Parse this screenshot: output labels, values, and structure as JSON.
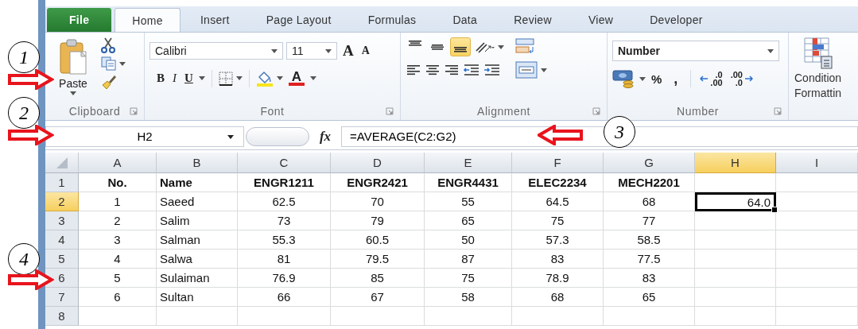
{
  "ribbon_tabs": [
    {
      "label": "File",
      "kind": "file",
      "selected": false
    },
    {
      "label": "Home",
      "kind": "tab",
      "selected": true
    },
    {
      "label": "Insert",
      "kind": "tab",
      "selected": false
    },
    {
      "label": "Page Layout",
      "kind": "tab",
      "selected": false
    },
    {
      "label": "Formulas",
      "kind": "tab",
      "selected": false
    },
    {
      "label": "Data",
      "kind": "tab",
      "selected": false
    },
    {
      "label": "Review",
      "kind": "tab",
      "selected": false
    },
    {
      "label": "View",
      "kind": "tab",
      "selected": false
    },
    {
      "label": "Developer",
      "kind": "tab",
      "selected": false
    }
  ],
  "clipboard": {
    "paste": "Paste",
    "group": "Clipboard"
  },
  "font": {
    "name": "Calibri",
    "size": "11",
    "grow": "A",
    "shrink": "A",
    "bold": "B",
    "italic": "I",
    "underline": "U",
    "font_color": "A",
    "group": "Font"
  },
  "alignment": {
    "vertical": [
      {
        "kind": "top",
        "selected": false
      },
      {
        "kind": "middle",
        "selected": false
      },
      {
        "kind": "bottom",
        "selected": true
      }
    ],
    "group": "Alignment"
  },
  "number": {
    "format": "Number",
    "percent": "%",
    "comma": ",",
    "increase_decimal": [
      ".0",
      ".00"
    ],
    "decrease_decimal": [
      ".00",
      ".0"
    ],
    "group": "Number"
  },
  "styles": {
    "conditional_formatting": [
      "Condition",
      "Formattin"
    ]
  },
  "formula_bar": {
    "name_box": "H2",
    "function_label": "fx",
    "formula": "=AVERAGE(C2:G2)"
  },
  "sheet": {
    "columns": [
      {
        "label": "A",
        "selected": false
      },
      {
        "label": "B",
        "selected": false
      },
      {
        "label": "C",
        "selected": false
      },
      {
        "label": "D",
        "selected": false
      },
      {
        "label": "E",
        "selected": false
      },
      {
        "label": "F",
        "selected": false
      },
      {
        "label": "G",
        "selected": false
      },
      {
        "label": "H",
        "selected": true
      },
      {
        "label": "I",
        "selected": false
      }
    ],
    "rows": [
      {
        "header": "1",
        "selected": false,
        "cells": [
          {
            "text": "No."
          },
          {
            "text": "Name"
          },
          {
            "text": "ENGR1211"
          },
          {
            "text": "ENGR2421"
          },
          {
            "text": "ENGR4431"
          },
          {
            "text": "ELEC2234"
          },
          {
            "text": "MECH2201"
          }
        ]
      },
      {
        "header": "2",
        "selected": true,
        "cells": [
          {
            "text": "1"
          },
          {
            "text": "Saeed"
          },
          {
            "text": "62.5"
          },
          {
            "text": "70"
          },
          {
            "text": "55"
          },
          {
            "text": "64.5"
          },
          {
            "text": "68"
          },
          {
            "text": "64.0",
            "active": true
          }
        ]
      },
      {
        "header": "3",
        "selected": false,
        "cells": [
          {
            "text": "2"
          },
          {
            "text": "Salim"
          },
          {
            "text": "73"
          },
          {
            "text": "79"
          },
          {
            "text": "65"
          },
          {
            "text": "75"
          },
          {
            "text": "77"
          }
        ]
      },
      {
        "header": "4",
        "selected": false,
        "cells": [
          {
            "text": "3"
          },
          {
            "text": "Salman"
          },
          {
            "text": "55.3"
          },
          {
            "text": "60.5"
          },
          {
            "text": "50"
          },
          {
            "text": "57.3"
          },
          {
            "text": "58.5"
          }
        ]
      },
      {
        "header": "5",
        "selected": false,
        "cells": [
          {
            "text": "4"
          },
          {
            "text": "Salwa"
          },
          {
            "text": "81"
          },
          {
            "text": "79.5"
          },
          {
            "text": "87"
          },
          {
            "text": "83"
          },
          {
            "text": "77.5"
          }
        ]
      },
      {
        "header": "6",
        "selected": false,
        "cells": [
          {
            "text": "5"
          },
          {
            "text": "Sulaiman"
          },
          {
            "text": "76.9"
          },
          {
            "text": "85"
          },
          {
            "text": "75"
          },
          {
            "text": "78.9"
          },
          {
            "text": "83"
          }
        ]
      },
      {
        "header": "7",
        "selected": false,
        "cells": [
          {
            "text": "6"
          },
          {
            "text": "Sultan"
          },
          {
            "text": "66"
          },
          {
            "text": "67"
          },
          {
            "text": "58"
          },
          {
            "text": "68"
          },
          {
            "text": "65"
          }
        ]
      },
      {
        "header": "8",
        "selected": false,
        "cells": []
      }
    ]
  },
  "callouts": [
    {
      "label": "1",
      "kind": "right"
    },
    {
      "label": "2",
      "kind": "right"
    },
    {
      "label": "3",
      "kind": "left"
    },
    {
      "label": "4",
      "kind": "right"
    }
  ]
}
